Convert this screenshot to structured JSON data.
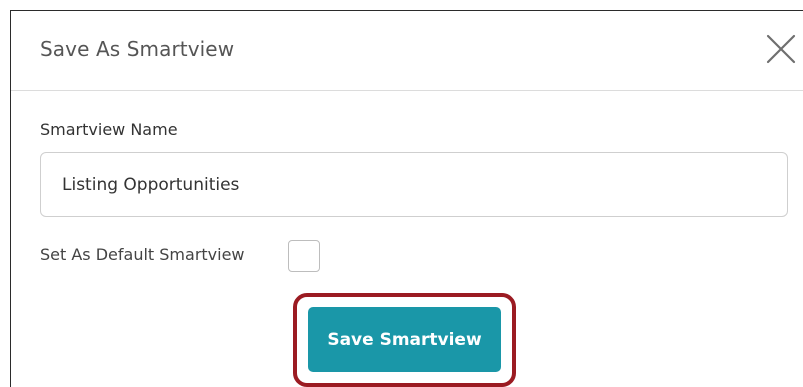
{
  "dialog": {
    "title": "Save As Smartview",
    "close_icon": "close-icon"
  },
  "form": {
    "name_label": "Smartview Name",
    "name_value": "Listing Opportunities",
    "default_label": "Set As Default Smartview",
    "default_checked": false
  },
  "actions": {
    "save_label": "Save Smartview",
    "save_color": "#1a97a8",
    "highlight_color": "#9b1b22"
  }
}
